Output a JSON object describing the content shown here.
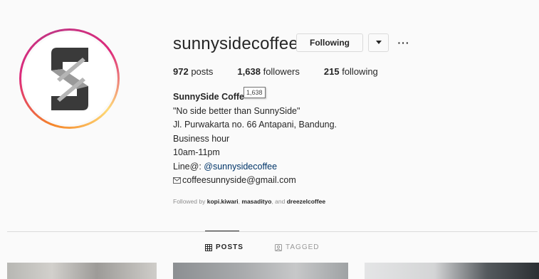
{
  "profile": {
    "username": "sunnysidecoffee",
    "following_button": "Following",
    "more_glyph": "···"
  },
  "stats": {
    "posts_count": "972",
    "posts_label": "posts",
    "followers_count": "1,638",
    "followers_label": "followers",
    "following_count": "215",
    "following_label": "following"
  },
  "tooltip": "1,638",
  "bio": {
    "name": "SunnySide Coffe",
    "line1": "\"No side better than SunnySide\"",
    "line2": "Jl. Purwakarta no. 66 Antapani, Bandung.",
    "line3": "Business hour",
    "line4": "10am-11pm",
    "line5_prefix": "Line@: ",
    "line5_link": "@sunnysidecoffee",
    "email": "coffeesunnyside@gmail.com"
  },
  "followed_by": {
    "prefix": "Followed by ",
    "user1": "kopi.kiwari",
    "sep1": ", ",
    "user2": "masadityo",
    "sep2": ", and ",
    "user3": "dreezelcoffee"
  },
  "tabs": {
    "posts": "POSTS",
    "tagged": "TAGGED"
  },
  "icons": {
    "dropdown": "caret-down-icon",
    "more": "more-horizontal-icon",
    "email": "envelope-icon",
    "posts": "grid-icon",
    "tagged": "tag-icon"
  }
}
